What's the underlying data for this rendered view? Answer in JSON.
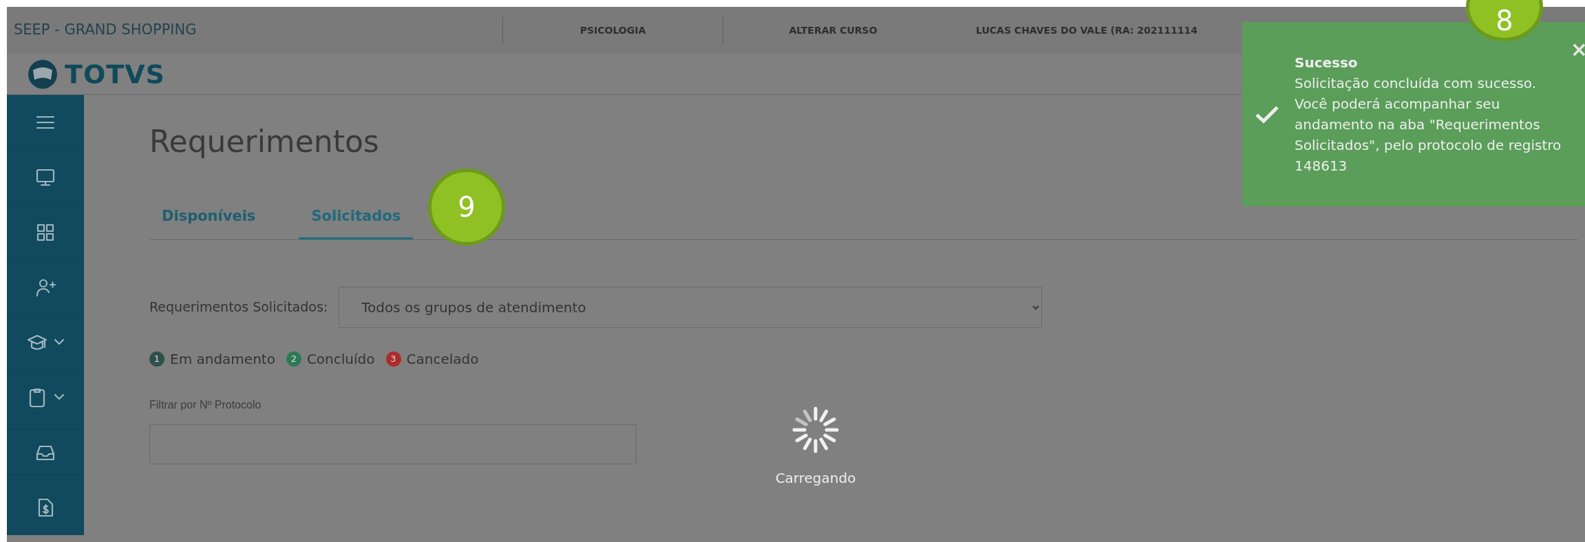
{
  "header": {
    "institution": "SEEP - GRAND SHOPPING",
    "course": "PSICOLOGIA",
    "change_course": "ALTERAR CURSO",
    "user": "LUCAS CHAVES DO VALE (RA: 202111114"
  },
  "logo": {
    "text": "TOTVS"
  },
  "sidebar": {
    "items": [
      {
        "kind": "menu",
        "expandable": false
      },
      {
        "kind": "monitor",
        "expandable": false
      },
      {
        "kind": "grid",
        "expandable": false
      },
      {
        "kind": "user-plus",
        "expandable": false
      },
      {
        "kind": "graduation",
        "expandable": true
      },
      {
        "kind": "clipboard",
        "expandable": true
      },
      {
        "kind": "inbox",
        "expandable": false
      },
      {
        "kind": "money-file",
        "expandable": false
      }
    ]
  },
  "page": {
    "title": "Requerimentos"
  },
  "tabs": [
    {
      "label": "Disponíveis",
      "selected": false
    },
    {
      "label": "Solicitados",
      "selected": true
    }
  ],
  "filter": {
    "label": "Requerimentos Solicitados:",
    "value": "Todos os grupos de atendimento"
  },
  "legend": [
    {
      "number": "1",
      "label": "Em andamento",
      "color": "#2f504d"
    },
    {
      "number": "2",
      "label": "Concluído",
      "color": "#2e7a57"
    },
    {
      "number": "3",
      "label": "Cancelado",
      "color": "#ad2b2b"
    }
  ],
  "protocol_filter": {
    "label": "Filtrar por Nº Protocolo"
  },
  "loading": {
    "text": "Carregando"
  },
  "toast": {
    "close": "×",
    "title": "Sucesso",
    "message": "Solicitação concluída com sucesso. Você poderá acompanhar seu andamento na aba \"Requerimentos Solicitados\", pelo protocolo de registro 148613"
  },
  "callouts": [
    {
      "number": "8"
    },
    {
      "number": "9"
    }
  ]
}
